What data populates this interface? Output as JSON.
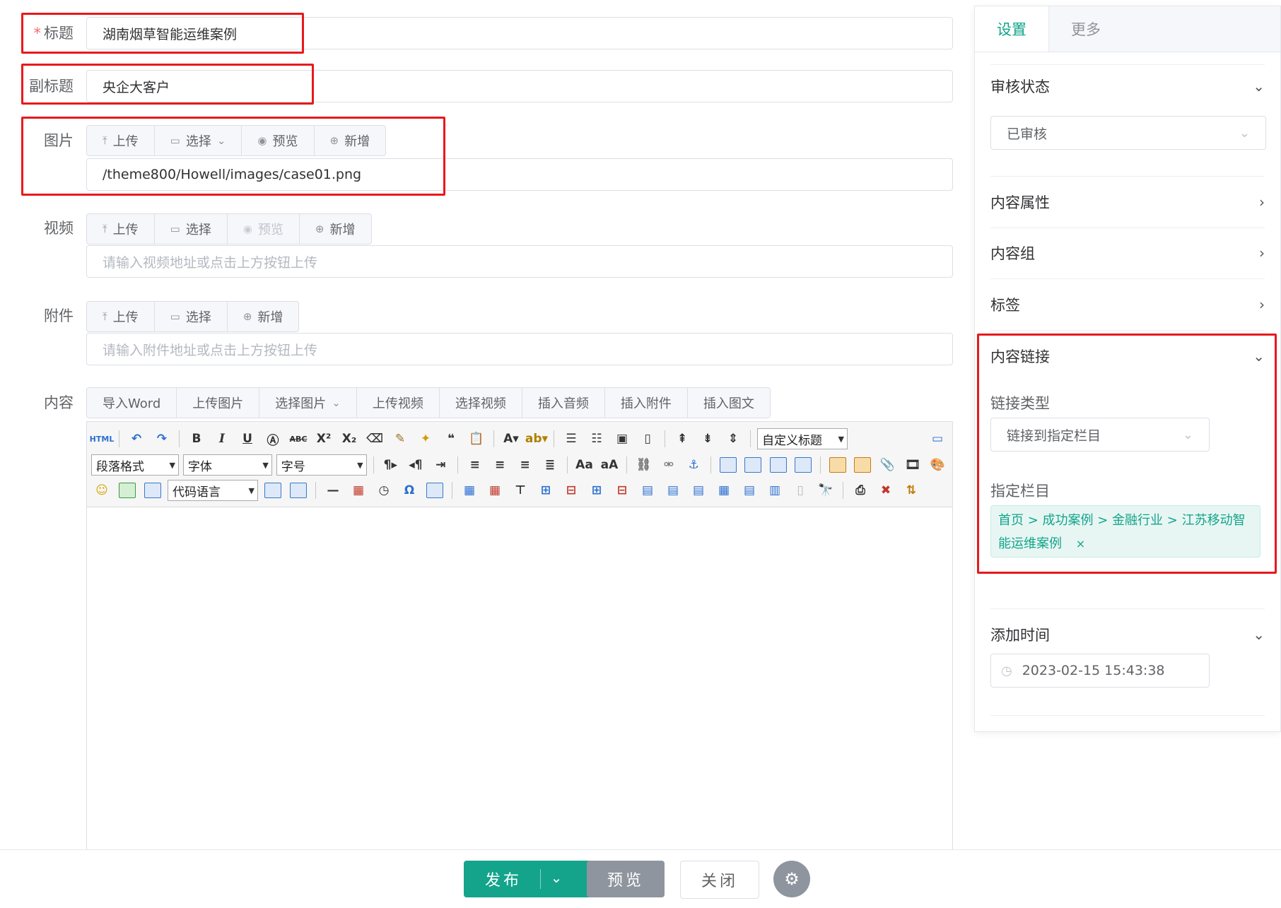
{
  "form": {
    "title": {
      "label": "标题",
      "required_mark": "*",
      "value": "湖南烟草智能运维案例"
    },
    "subtitle": {
      "label": "副标题",
      "value": "央企大客户"
    },
    "image": {
      "label": "图片",
      "buttons": {
        "upload": "上传",
        "select": "选择",
        "preview": "预览",
        "add": "新增"
      },
      "value": "/theme800/Howell/images/case01.png"
    },
    "video": {
      "label": "视频",
      "buttons": {
        "upload": "上传",
        "select": "选择",
        "preview": "预览",
        "add": "新增"
      },
      "placeholder": "请输入视频地址或点击上方按钮上传"
    },
    "attachment": {
      "label": "附件",
      "buttons": {
        "upload": "上传",
        "select": "选择",
        "add": "新增"
      },
      "placeholder": "请输入附件地址或点击上方按钮上传"
    },
    "content": {
      "label": "内容",
      "buttons": {
        "import_word": "导入Word",
        "upload_image": "上传图片",
        "select_image": "选择图片",
        "upload_video": "上传视频",
        "select_video": "选择视频",
        "insert_audio": "插入音频",
        "insert_attachment": "插入附件",
        "insert_rich": "插入图文"
      },
      "editor": {
        "html_label": "HTML",
        "custom_title": "自定义标题",
        "paragraph_format": "段落格式",
        "font_family": "字体",
        "font_size": "字号",
        "code_language": "代码语言"
      }
    }
  },
  "panel": {
    "tabs": {
      "settings": "设置",
      "more": "更多"
    },
    "review_status": {
      "title": "审核状态",
      "value": "已审核"
    },
    "content_attributes": {
      "title": "内容属性"
    },
    "content_group": {
      "title": "内容组"
    },
    "tags": {
      "title": "标签"
    },
    "content_link": {
      "title": "内容链接",
      "link_type_label": "链接类型",
      "link_type_value": "链接到指定栏目",
      "target_column_label": "指定栏目",
      "target_column_value": "首页 > 成功案例 > 金融行业 > 江苏移动智能运维案例",
      "remove": "×"
    },
    "add_time": {
      "title": "添加时间",
      "value": "2023-02-15 15:43:38"
    }
  },
  "footer": {
    "publish": "发布",
    "preview": "预览",
    "close": "关闭"
  },
  "colors": {
    "accent": "#13a48b",
    "highlight_border": "#e8191c",
    "preview_button": "#8f959e"
  }
}
